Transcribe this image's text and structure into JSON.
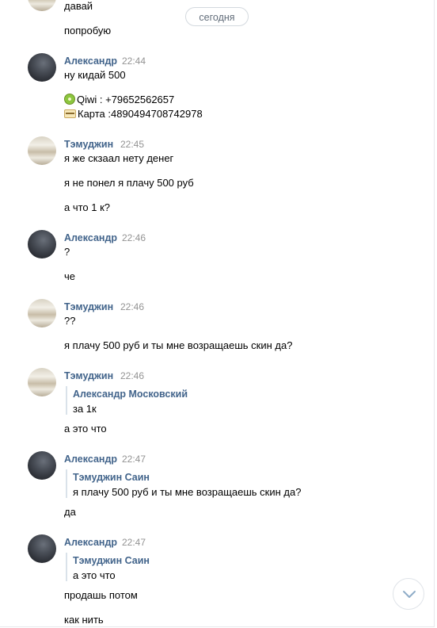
{
  "date_separator": "сегодня",
  "top": {
    "lines": [
      "давай",
      "попробую"
    ]
  },
  "messages": [
    {
      "author": "Александр",
      "time": "22:44",
      "lines": [
        "ну кидай 500"
      ],
      "payment": {
        "qiwi": "Qiwi : +79652562657",
        "card": "Карта :4890494708742978"
      }
    },
    {
      "author": "Тэмуджин",
      "time": "22:45",
      "lines": [
        "я же скзаал нету денег",
        "я не понел я плачу 500 руб",
        "а что 1 к?"
      ]
    },
    {
      "author": "Александр",
      "time": "22:46",
      "lines": [
        "?",
        "че"
      ]
    },
    {
      "author": "Тэмуджин",
      "time": "22:46",
      "lines": [
        "??",
        "я плачу 500 руб и ты мне возращаешь скин да?"
      ]
    },
    {
      "author": "Тэмуджин",
      "time": "22:46",
      "quote": {
        "author": "Александр Московский",
        "text": "за 1к"
      },
      "lines": [
        "а это что"
      ]
    },
    {
      "author": "Александр",
      "time": "22:47",
      "quote": {
        "author": "Тэмуджин Саин",
        "text": "я плачу 500 руб и ты мне возращаешь скин да?"
      },
      "lines": [
        "да"
      ]
    },
    {
      "author": "Александр",
      "time": "22:47",
      "quote": {
        "author": "Тэмуджин Саин",
        "text": "а это что"
      },
      "lines": [
        "продашь потом",
        "как нить"
      ]
    }
  ],
  "icons": {
    "scroll_down": "chevron-down-icon"
  },
  "colors": {
    "author": "#42648b",
    "time": "#939393",
    "quote_bar": "#dae2ea"
  }
}
